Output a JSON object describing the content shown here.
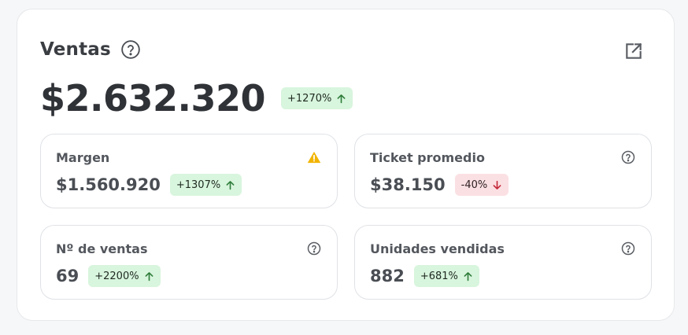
{
  "panel": {
    "title": "Ventas",
    "total": "$2.632.320",
    "total_change": "+1270%",
    "total_trend": "up"
  },
  "metrics": [
    {
      "label": "Margen",
      "value": "$1.560.920",
      "change": "+1307%",
      "trend": "up",
      "corner_icon": "warning-icon"
    },
    {
      "label": "Ticket promedio",
      "value": "$38.150",
      "change": "-40%",
      "trend": "down",
      "corner_icon": "help-icon"
    },
    {
      "label": "Nº de ventas",
      "value": "69",
      "change": "+2200%",
      "trend": "up",
      "corner_icon": "help-icon"
    },
    {
      "label": "Unidades vendidas",
      "value": "882",
      "change": "+681%",
      "trend": "up",
      "corner_icon": "help-icon"
    }
  ],
  "colors": {
    "up_bg": "#d8f5dd",
    "up_arrow": "#2e7d3a",
    "down_bg": "#fbe0e3",
    "down_arrow": "#c4293b",
    "warning": "#f2b400"
  }
}
